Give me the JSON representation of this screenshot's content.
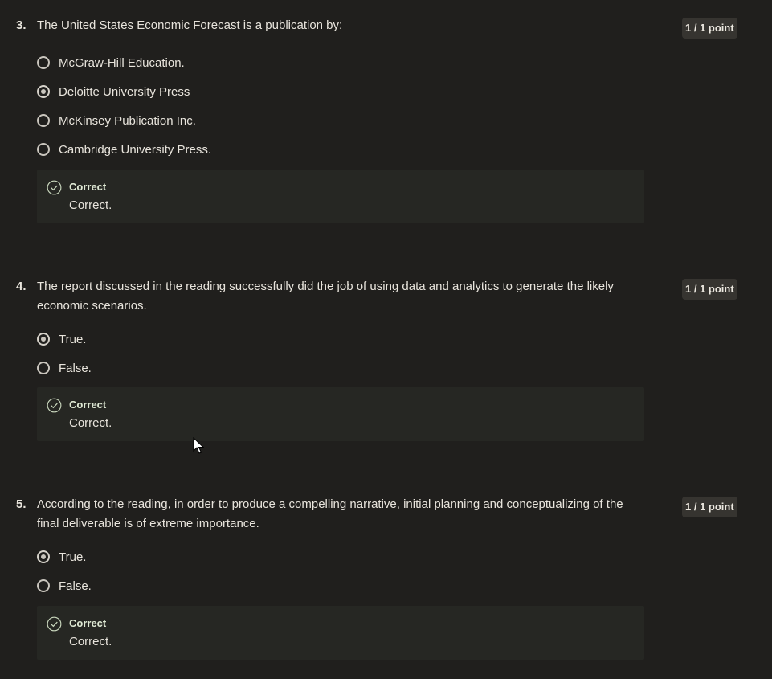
{
  "questions": [
    {
      "number": "3.",
      "text": "The United States Economic Forecast is a publication by:",
      "points": "1 / 1 point",
      "options": [
        {
          "label": "McGraw-Hill Education.",
          "selected": false
        },
        {
          "label": "Deloitte University Press",
          "selected": true
        },
        {
          "label": "McKinsey Publication Inc.",
          "selected": false
        },
        {
          "label": "Cambridge University Press.",
          "selected": false
        }
      ],
      "feedback": {
        "title": "Correct",
        "text": "Correct."
      }
    },
    {
      "number": "4.",
      "text": "The report discussed in the reading successfully did the job of using data and analytics to generate the likely economic scenarios.",
      "points": "1 / 1 point",
      "options": [
        {
          "label": "True.",
          "selected": true
        },
        {
          "label": "False.",
          "selected": false
        }
      ],
      "feedback": {
        "title": "Correct",
        "text": "Correct."
      }
    },
    {
      "number": "5.",
      "text": "According to the reading, in order to produce a compelling narrative, initial planning and conceptualizing of the final deliverable is of extreme importance.",
      "points": "1 / 1 point",
      "options": [
        {
          "label": "True.",
          "selected": true
        },
        {
          "label": "False.",
          "selected": false
        }
      ],
      "feedback": {
        "title": "Correct",
        "text": "Correct."
      }
    }
  ],
  "icons": {
    "feedback": "check-circle-icon",
    "pointer": "mouse-cursor-icon"
  },
  "colors": {
    "background": "#201f1d",
    "feedback_bg": "#262723",
    "badge_bg": "#363430",
    "correct_text": "#dfe9d4"
  }
}
